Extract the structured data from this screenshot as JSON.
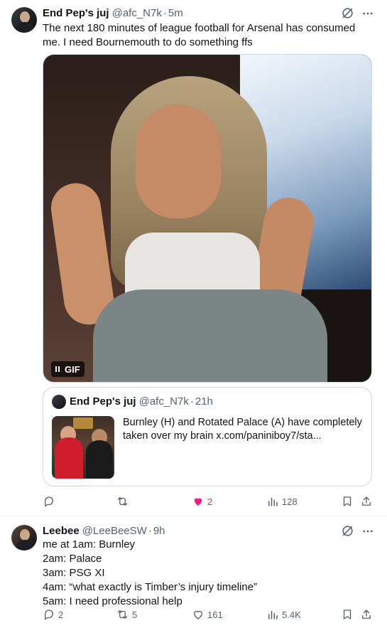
{
  "tweets": [
    {
      "author_name": "End Pep's juj",
      "handle": "@afc_N7k",
      "separator": "·",
      "time": "5m",
      "text": "The next 180 minutes of league football for Arsenal has consumed me. I need Bournemouth to do something ffs",
      "media": {
        "badge": "GIF"
      },
      "quote": {
        "author_name": "End Pep's juj",
        "handle": "@afc_N7k",
        "separator": "·",
        "time": "21h",
        "text": "Burnley (H) and Rotated Palace (A) have completely taken over my brain  x.com/paniniboy7/sta..."
      },
      "actions": {
        "reply": "",
        "retweet": "",
        "like": "2",
        "views": "128"
      }
    },
    {
      "author_name": "Leebee",
      "handle": "@LeeBeeSW",
      "separator": "·",
      "time": "9h",
      "text": "me at 1am: Burnley\n2am: Palace\n3am: PSG XI\n4am: “what exactly is Timber’s injury timeline”\n5am: I need professional help",
      "actions": {
        "reply": "2",
        "retweet": "5",
        "like": "161",
        "views": "5.4K"
      }
    }
  ],
  "colors": {
    "text": "#0f1419",
    "secondary": "#536471",
    "like_active": "#f91880",
    "border": "#cfd9de"
  },
  "icons": [
    "grok-icon",
    "more-icon",
    "reply-icon",
    "retweet-icon",
    "like-icon",
    "views-icon",
    "bookmark-icon",
    "share-icon"
  ]
}
